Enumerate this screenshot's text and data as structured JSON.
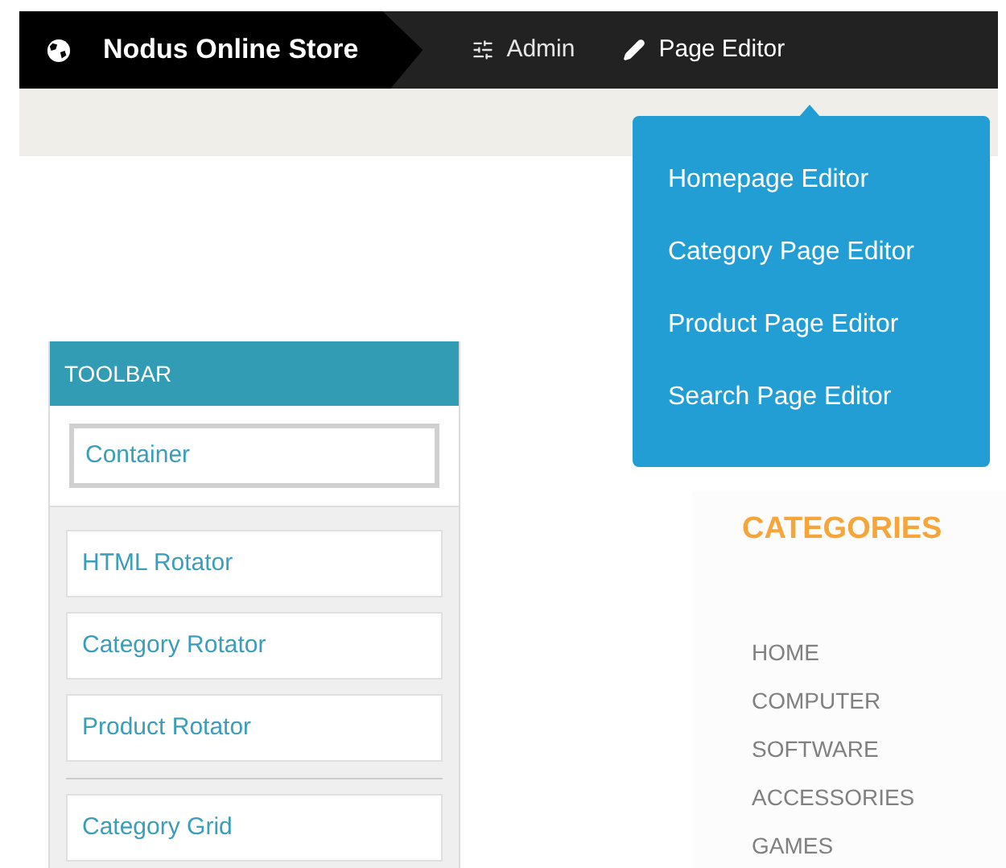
{
  "navbar": {
    "brand": "Nodus Online Store",
    "items": [
      {
        "label": "Admin",
        "selected": false
      },
      {
        "label": "Page Editor",
        "selected": true
      }
    ]
  },
  "dropdown": {
    "items": [
      "Homepage Editor",
      "Category Page Editor",
      "Product Page Editor",
      "Search Page Editor"
    ]
  },
  "toolbar": {
    "title": "TOOLBAR",
    "groups": [
      {
        "kind": "container",
        "items": [
          "Container"
        ]
      },
      {
        "kind": "widgets",
        "items": [
          "HTML Rotator",
          "Category Rotator",
          "Product Rotator"
        ]
      },
      {
        "kind": "widgets",
        "items": [
          "Category Grid"
        ]
      }
    ]
  },
  "categories": {
    "title": "CATEGORIES",
    "items": [
      "HOME",
      "COMPUTER",
      "SOFTWARE",
      "ACCESSORIES",
      "GAMES"
    ]
  }
}
